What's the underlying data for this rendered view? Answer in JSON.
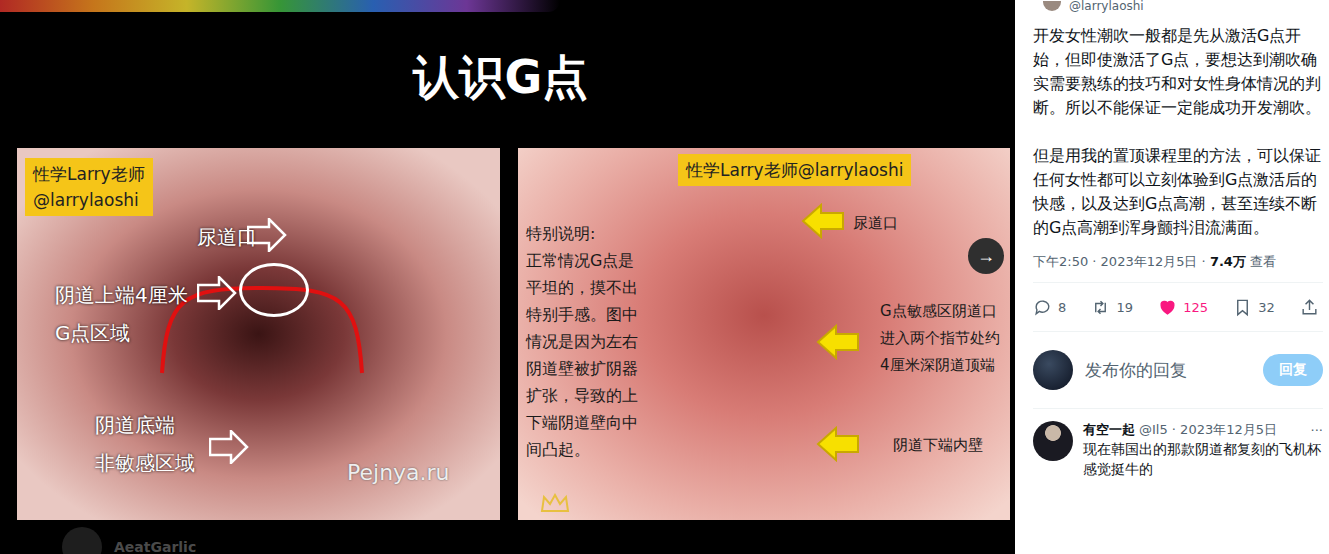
{
  "slide": {
    "title": "认识G点",
    "next_icon": "→"
  },
  "left_image": {
    "badge": [
      "性学Larry老师",
      "@larrylaoshi"
    ],
    "labels": [
      {
        "lines": [
          "尿道口"
        ]
      },
      {
        "lines": [
          "阴道上端4厘米",
          "G点区域"
        ]
      },
      {
        "lines": [
          "阴道底端",
          "非敏感区域"
        ]
      }
    ],
    "watermark": "Pejnya.ru"
  },
  "right_image": {
    "badge": [
      "性学Larry老师@larrylaoshi"
    ],
    "note": [
      "特别说明:",
      "正常情况G点是",
      "平坦的，摸不出",
      "特别手感。图中",
      "情况是因为左右",
      "阴道壁被扩阴器",
      "扩张，导致的上",
      "下端阴道壁向中",
      "间凸起。"
    ],
    "labels": [
      {
        "lines": [
          "尿道口"
        ]
      },
      {
        "lines": [
          "G点敏感区阴道口",
          "进入两个指节处约",
          "4厘米深阴道顶端"
        ]
      },
      {
        "lines": [
          "阴道下端内壁"
        ]
      }
    ]
  },
  "bottom_user": "AeatGarlic",
  "post": {
    "handle": "@larrylaoshi",
    "paragraphs": [
      "开发女性潮吹一般都是先从激活G点开始，但即使激活了G点，要想达到潮吹确实需要熟练的技巧和对女性身体情况的判断。所以不能保证一定能成功开发潮吹。",
      "但是用我的置顶课程里的方法，可以保证任何女性都可以立刻体验到G点激活后的快感，以及达到G点高潮，甚至连续不断的G点高潮到浑身颤抖泪流满面。"
    ],
    "time": "下午2:50 · 2023年12月5日 · ",
    "views": "7.4万",
    "views_label": " 查看",
    "stats": [
      {
        "kind": "reply",
        "count": "8",
        "active": false
      },
      {
        "kind": "repost",
        "count": "19",
        "active": false
      },
      {
        "kind": "like",
        "count": "125",
        "active": true
      },
      {
        "kind": "bookmark",
        "count": "32",
        "active": false
      },
      {
        "kind": "share",
        "active": false
      }
    ]
  },
  "composer": {
    "placeholder": "发布你的回复",
    "button": "回复",
    "button_disabled": true
  },
  "replies": [
    {
      "name": "有空一起",
      "meta": "@Il5 · 2023年12月5日",
      "more": "···",
      "text": "现在韩国出的那款阴道都复刻的飞机杯感觉挺牛的"
    }
  ]
}
